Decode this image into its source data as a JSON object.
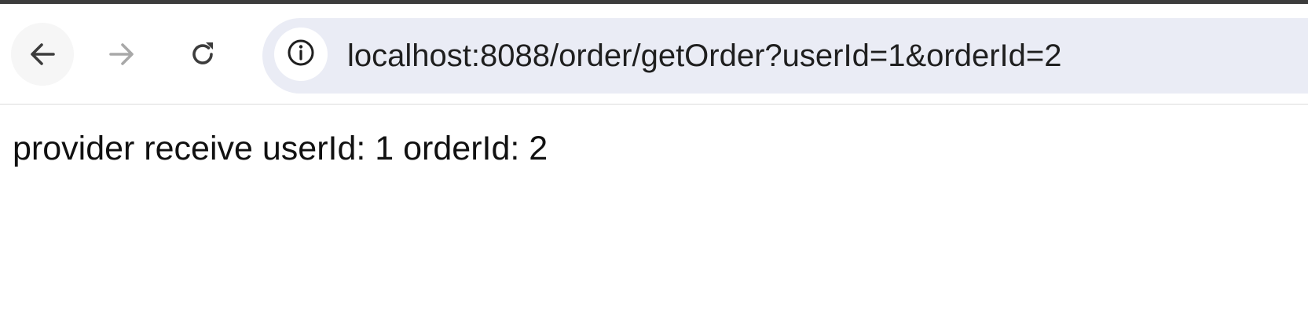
{
  "browser": {
    "toolbar": {
      "back_icon": "arrow-left-icon",
      "forward_icon": "arrow-right-icon",
      "reload_icon": "reload-icon",
      "site_info_icon": "info-icon"
    },
    "address_bar": {
      "url": "localhost:8088/order/getOrder?userId=1&orderId=2"
    }
  },
  "page": {
    "body_text": "provider receive userId: 1 orderId: 2"
  },
  "colors": {
    "omnibox_bg": "#eaecf5",
    "top_strip": "#3c3c3c",
    "forward_disabled": "#a8a8a8"
  }
}
